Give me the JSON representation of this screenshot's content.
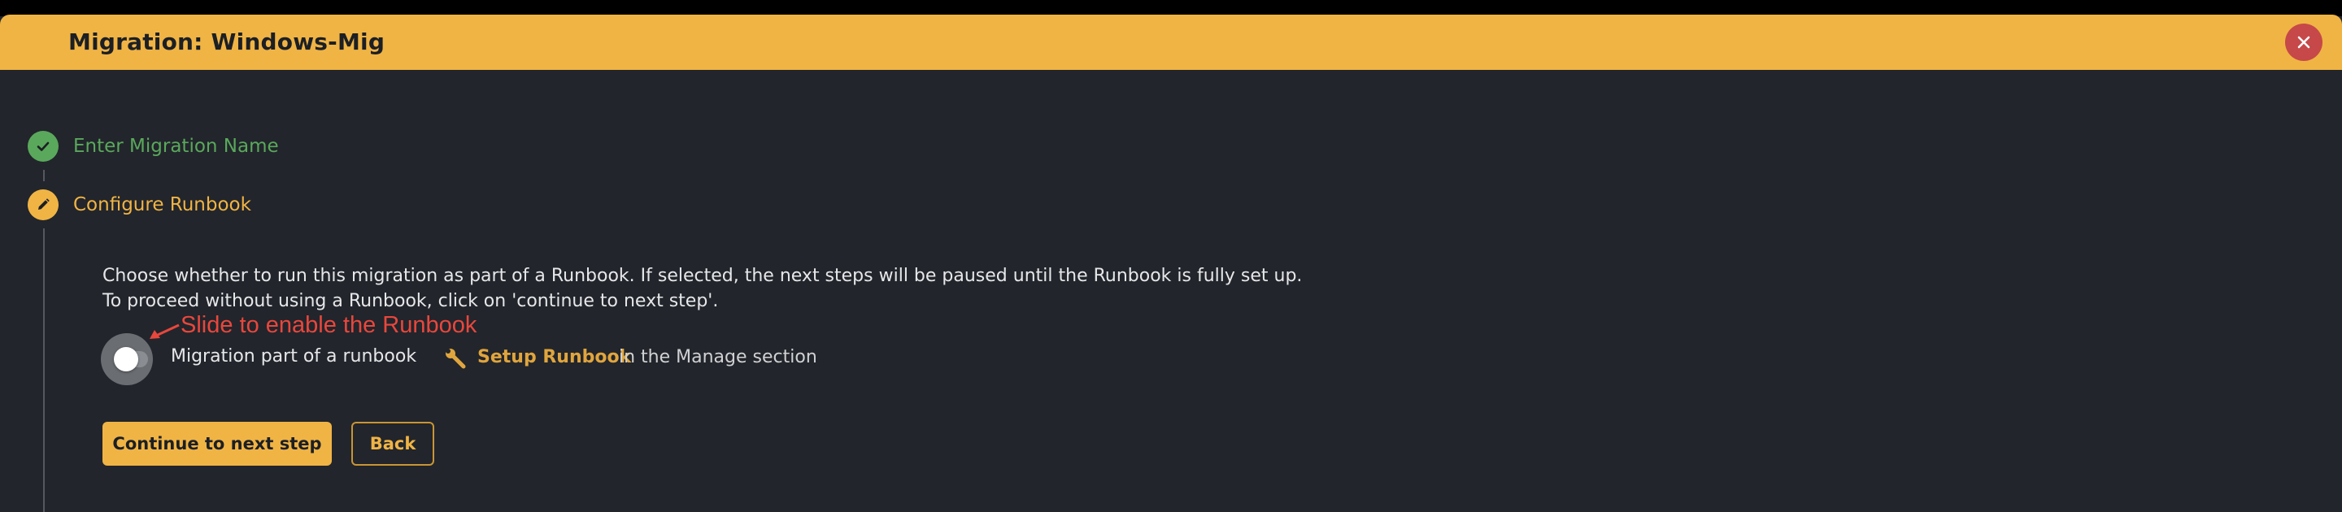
{
  "dialog": {
    "title": "Migration: Windows-Mig",
    "close_icon": "close-icon"
  },
  "steps": [
    {
      "label": "Enter Migration Name",
      "status": "complete",
      "icon": "check-icon",
      "color": "#5aa85c"
    },
    {
      "label": "Configure Runbook",
      "status": "active",
      "icon": "pencil-icon",
      "color": "#f0b445"
    }
  ],
  "runbook": {
    "description_line1": "Choose whether to run this migration as part of a Runbook. If selected, the next steps will be paused until the Runbook is fully set up.",
    "description_line2": "To proceed without using a Runbook, click on 'continue to next step'.",
    "annotation": "Slide to enable the Runbook",
    "toggle_label": "Migration part of a runbook",
    "toggle_on": false,
    "setup_link": "Setup Runbook",
    "setup_suffix": "in the Manage section",
    "setup_icon": "wrench-icon"
  },
  "actions": {
    "continue_label": "Continue to next step",
    "back_label": "Back"
  },
  "colors": {
    "accent": "#f0b445",
    "success": "#5aa85c",
    "danger": "#c64848",
    "background": "#22252b",
    "annotation": "#e8473d"
  }
}
